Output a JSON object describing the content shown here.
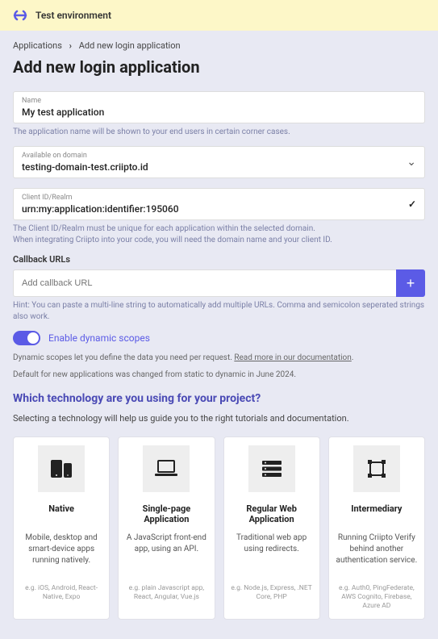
{
  "banner": {
    "text": "Test environment"
  },
  "breadcrumb": {
    "root": "Applications",
    "current": "Add new login application"
  },
  "page_title": "Add new login application",
  "name_field": {
    "label": "Name",
    "value": "My test application"
  },
  "name_help": "The application name will be shown to your end users in certain corner cases.",
  "domain_field": {
    "label": "Available on domain",
    "value": "testing-domain-test.criipto.id"
  },
  "client_field": {
    "label": "Client ID/Realm",
    "value": "urn:my:application:identifier:195060"
  },
  "client_help1": "The Client ID/Realm must be unique for each application within the selected domain.",
  "client_help2": "When integrating Criipto into your code, you will need the domain name and your client ID.",
  "callback": {
    "label": "Callback URLs",
    "placeholder": "Add callback URL",
    "add": "+"
  },
  "callback_hint": "Hint: You can paste a multi-line string to automatically add multiple URLs. Comma and semicolon seperated strings also work.",
  "scopes": {
    "toggle_label": "Enable dynamic scopes",
    "desc_prefix": "Dynamic scopes let you define the data you need per request. ",
    "link": "Read more in our documentation",
    "default_note": "Default for new applications was changed from static to dynamic in June 2024."
  },
  "tech": {
    "heading": "Which technology are you using for your project?",
    "sub": "Selecting a technology will help us guide you to the right tutorials and documentation.",
    "cards": [
      {
        "title": "Native",
        "desc": "Mobile, desktop and smart-device apps running natively.",
        "eg": "e.g. iOS, Android, React-Native, Expo"
      },
      {
        "title": "Single-page Application",
        "desc": "A JavaScript front-end app, using an API.",
        "eg": "e.g. plain Javascript app, React, Angular, Vue.js"
      },
      {
        "title": "Regular Web Application",
        "desc": "Traditional web app using redirects.",
        "eg": "e.g. Node.js, Express, .NET Core, PHP"
      },
      {
        "title": "Intermediary",
        "desc": "Running Criipto Verify behind another authentication service.",
        "eg": "e.g. Auth0, PingFederate, AWS Cognito, Firebase, Azure AD"
      }
    ]
  }
}
